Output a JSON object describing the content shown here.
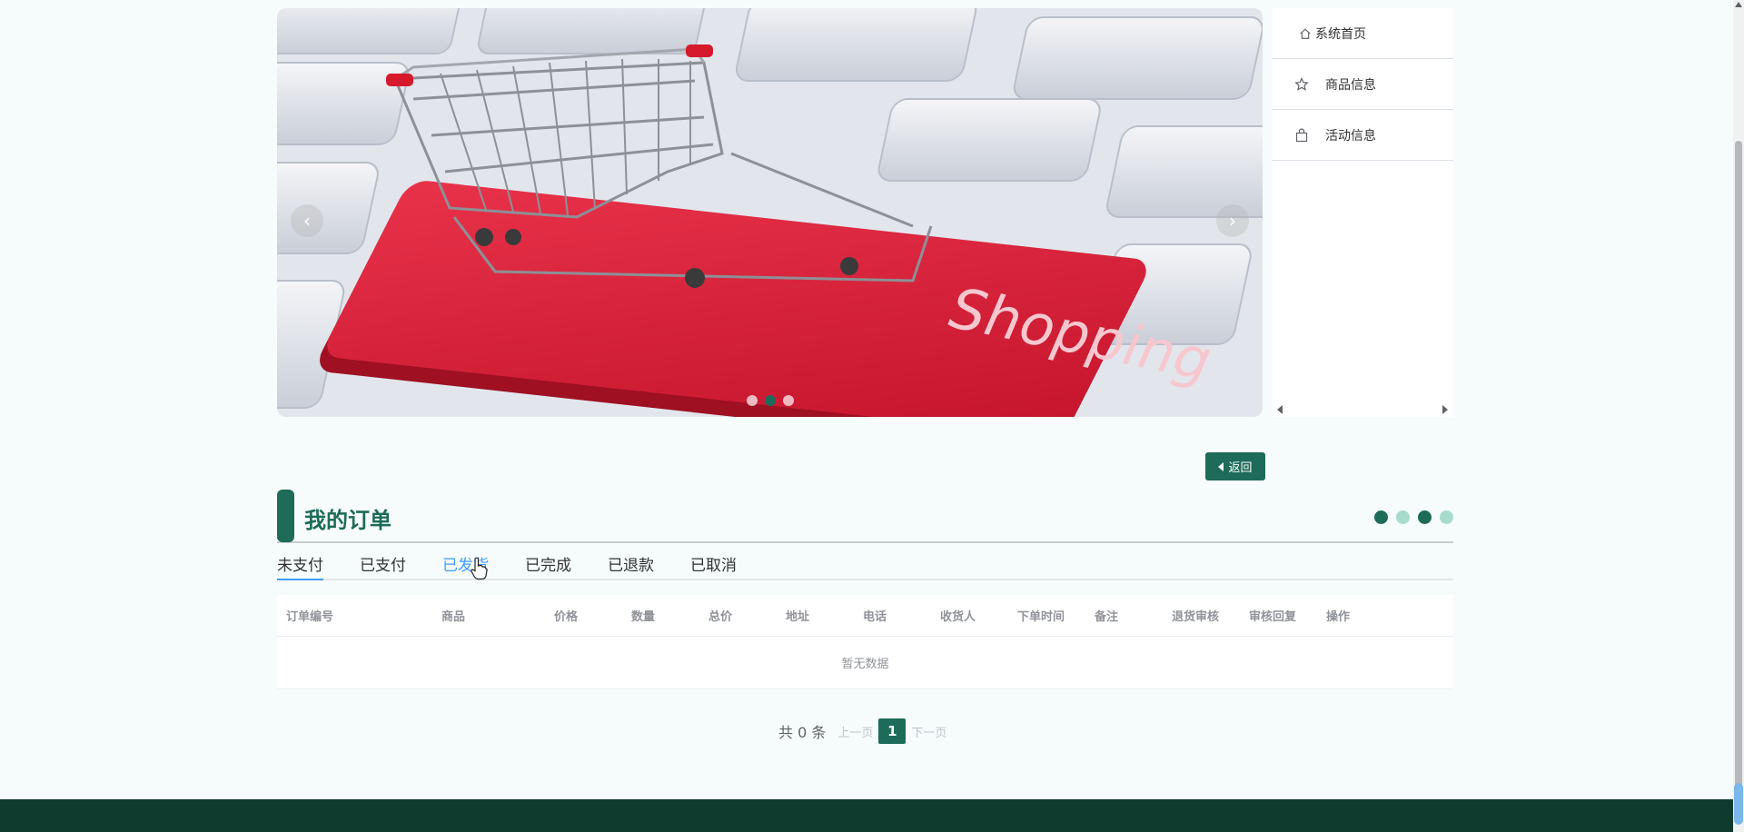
{
  "carousel": {
    "banner_text": "Shopping",
    "prev_label": "‹",
    "next_label": "›",
    "slides": [
      {
        "active": false
      },
      {
        "active": true
      },
      {
        "active": false
      }
    ]
  },
  "side_menu": {
    "items": [
      {
        "label": "系统首页",
        "icon": "home-icon"
      },
      {
        "label": "商品信息",
        "icon": "star-icon"
      },
      {
        "label": "活动信息",
        "icon": "bag-icon"
      }
    ]
  },
  "back_button": {
    "label": "返回"
  },
  "section": {
    "title": "我的订单"
  },
  "tabs": [
    {
      "label": "未支付",
      "active": true
    },
    {
      "label": "已支付",
      "active": false
    },
    {
      "label": "已发货",
      "active": false,
      "hover": true
    },
    {
      "label": "已完成",
      "active": false
    },
    {
      "label": "已退款",
      "active": false
    },
    {
      "label": "已取消",
      "active": false
    }
  ],
  "table": {
    "columns": [
      "订单编号",
      "商品",
      "价格",
      "数量",
      "总价",
      "地址",
      "电话",
      "收货人",
      "下单时间",
      "备注",
      "退货审核",
      "审核回复",
      "操作"
    ],
    "empty_text": "暂无数据"
  },
  "pagination": {
    "total_label": "共 0 条",
    "prev_label": "上一页",
    "current_page": "1",
    "next_label": "下一页"
  },
  "colors": {
    "primary": "#1d6b58",
    "accent_light": "#a7dccd",
    "tab_active": "#409eff",
    "footer": "#0f3a2e"
  }
}
